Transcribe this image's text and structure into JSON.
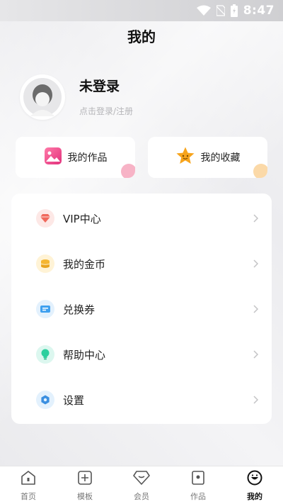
{
  "status_bar": {
    "time": "8:47"
  },
  "header": {
    "title": "我的"
  },
  "profile": {
    "name": "未登录",
    "hint": "点击登录/注册"
  },
  "quick_cards": [
    {
      "label": "我的作品",
      "icon": "picture-icon",
      "dot_color": "#f7b3c6"
    },
    {
      "label": "我的收藏",
      "icon": "star-icon",
      "dot_color": "#fbd9a8"
    }
  ],
  "menu": [
    {
      "label": "VIP中心",
      "icon": "diamond-icon",
      "icon_bg": "#fde8e6",
      "icon_color": "#f0695c"
    },
    {
      "label": "我的金币",
      "icon": "coins-icon",
      "icon_bg": "#fff3d6",
      "icon_color": "#f5b631"
    },
    {
      "label": "兑换券",
      "icon": "ticket-icon",
      "icon_bg": "#e3f1fd",
      "icon_color": "#3fa0ef"
    },
    {
      "label": "帮助中心",
      "icon": "lightbulb-icon",
      "icon_bg": "#dcf7ef",
      "icon_color": "#2ccf9e"
    },
    {
      "label": "设置",
      "icon": "gear-icon",
      "icon_bg": "#e3f1fd",
      "icon_color": "#3a8fe0"
    }
  ],
  "tabs": [
    {
      "label": "首页",
      "icon": "home-icon",
      "active": false
    },
    {
      "label": "模板",
      "icon": "template-icon",
      "active": false
    },
    {
      "label": "会员",
      "icon": "member-diamond-icon",
      "active": false
    },
    {
      "label": "作品",
      "icon": "works-icon",
      "active": false
    },
    {
      "label": "我的",
      "icon": "smile-icon",
      "active": true
    }
  ],
  "colors": {
    "background": "#f2f2f4",
    "card": "#ffffff",
    "text": "#1a1a1a",
    "muted": "#b5b5b8"
  }
}
